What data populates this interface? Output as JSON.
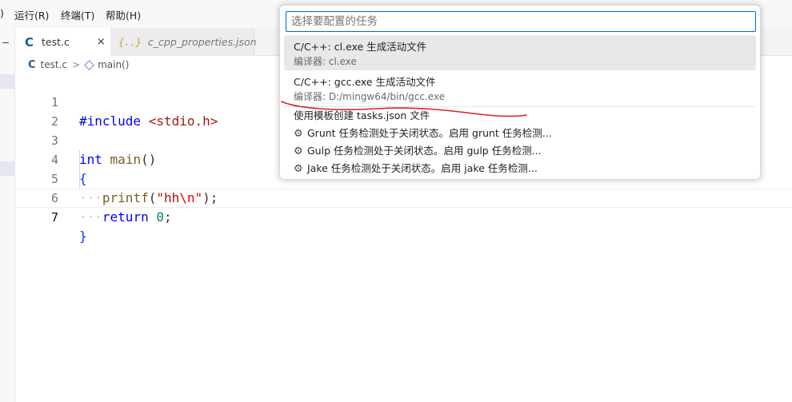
{
  "menubar": {
    "items": [
      {
        "label": ")"
      },
      {
        "label": "运行(R)"
      },
      {
        "label": "终端(T)"
      },
      {
        "label": "帮助(H)"
      }
    ]
  },
  "tabs": [
    {
      "icon": "C",
      "label": "test.c",
      "close": "×"
    },
    {
      "icon": "{..}",
      "label": "c_cpp_properties.json"
    }
  ],
  "breadcrumb": {
    "icon": "C",
    "file": "test.c",
    "separator": ">",
    "symbol": "main()"
  },
  "editor": {
    "lines": [
      {
        "n": "1"
      },
      {
        "n": "2"
      },
      {
        "n": "3"
      },
      {
        "n": "4"
      },
      {
        "n": "5"
      },
      {
        "n": "6"
      },
      {
        "n": "7"
      }
    ],
    "tokens": {
      "include": "#include",
      "header": "<stdio.h>",
      "int": "int",
      "main": "main",
      "parens": "()",
      "open_brace": "{",
      "close_brace": "}",
      "indent_dots": "···",
      "printf": "printf",
      "open_paren": "(",
      "str_open": "\"hh",
      "esc": "\\n",
      "str_close": "\"",
      "close_stmt": ");",
      "return": "return",
      "zero": "0",
      "semicolon": ";"
    }
  },
  "quickpick": {
    "placeholder": "选择要配置的任务",
    "items": [
      {
        "label": "C/C++: cl.exe 生成活动文件",
        "description": "编译器: cl.exe"
      },
      {
        "label": "C/C++: gcc.exe 生成活动文件",
        "description": "编译器: D:/mingw64/bin/gcc.exe"
      },
      {
        "label": "使用模板创建 tasks.json 文件"
      },
      {
        "label": "Grunt 任务检测处于关闭状态。启用 grunt 任务检测..."
      },
      {
        "label": "Gulp 任务检测处于关闭状态。启用 gulp 任务检测..."
      },
      {
        "label": "Jake 任务检测处于关闭状态。启用 jake 任务检测..."
      }
    ],
    "gear_glyph": "⚙"
  },
  "annotation_color": "#e02020"
}
